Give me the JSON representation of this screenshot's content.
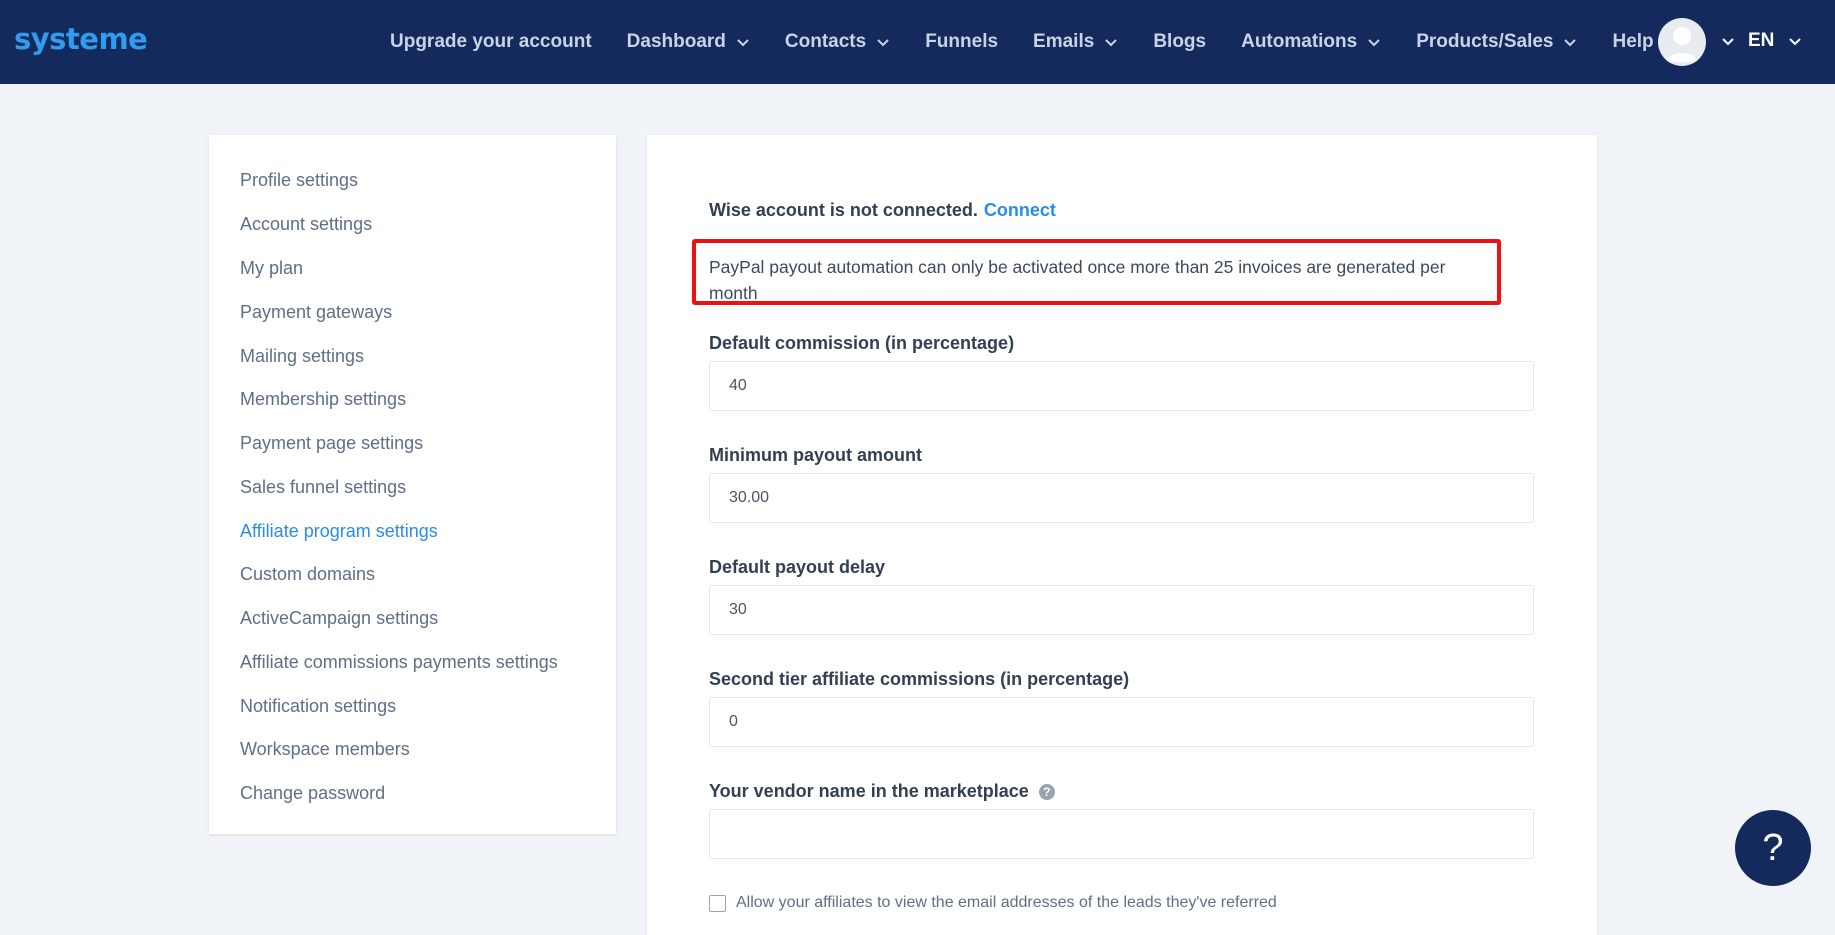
{
  "brand": {
    "logo_text": "systeme"
  },
  "nav": {
    "items": [
      {
        "label": "Upgrade your account",
        "dropdown": false
      },
      {
        "label": "Dashboard",
        "dropdown": true
      },
      {
        "label": "Contacts",
        "dropdown": true
      },
      {
        "label": "Funnels",
        "dropdown": false
      },
      {
        "label": "Emails",
        "dropdown": true
      },
      {
        "label": "Blogs",
        "dropdown": false
      },
      {
        "label": "Automations",
        "dropdown": true
      },
      {
        "label": "Products/Sales",
        "dropdown": true
      },
      {
        "label": "Help",
        "dropdown": false
      }
    ],
    "language": "EN",
    "avatar_icon": "user-avatar-icon"
  },
  "sidebar": {
    "items": [
      {
        "label": "Profile settings"
      },
      {
        "label": "Account settings"
      },
      {
        "label": "My plan"
      },
      {
        "label": "Payment gateways"
      },
      {
        "label": "Mailing settings"
      },
      {
        "label": "Membership settings"
      },
      {
        "label": "Payment page settings"
      },
      {
        "label": "Sales funnel settings"
      },
      {
        "label": "Affiliate program settings",
        "active": true
      },
      {
        "label": "Custom domains"
      },
      {
        "label": "ActiveCampaign settings"
      },
      {
        "label": "Affiliate commissions payments settings"
      },
      {
        "label": "Notification settings"
      },
      {
        "label": "Workspace members"
      },
      {
        "label": "Change password"
      }
    ]
  },
  "main": {
    "wise_status": "Wise account is not connected.",
    "wise_connect_link": "Connect",
    "notice": "PayPal payout automation can only be activated once more than 25 invoices are generated per month",
    "fields": [
      {
        "label": "Default commission (in percentage)",
        "value": "40"
      },
      {
        "label": "Minimum payout amount",
        "value": "30.00"
      },
      {
        "label": "Default payout delay",
        "value": "30"
      },
      {
        "label": "Second tier affiliate commissions (in percentage)",
        "value": "0"
      },
      {
        "label": "Your vendor name in the marketplace",
        "value": "",
        "help_icon": "question-circle-icon"
      }
    ],
    "checkbox_label": "Allow your affiliates to view the email addresses of the leads they've referred",
    "checkbox_checked": false
  },
  "help_fab": {
    "label": "?"
  },
  "colors": {
    "nav_bg": "#142a5c",
    "accent": "#2b8ce8",
    "notice_border": "#ee1111",
    "page_bg": "#f0f4f8"
  }
}
